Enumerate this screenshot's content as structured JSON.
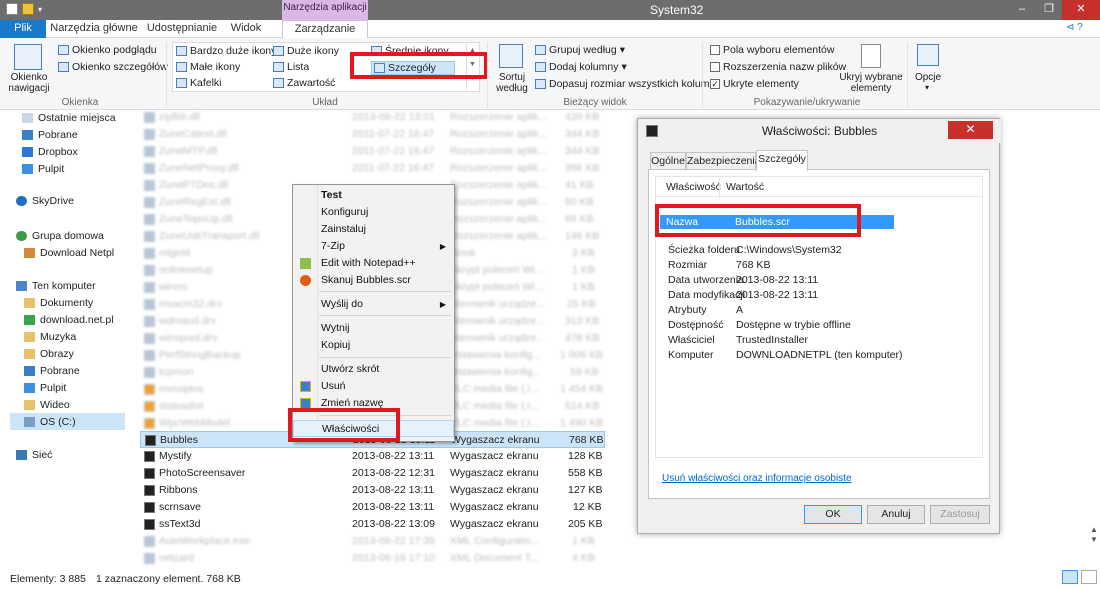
{
  "window": {
    "title": "System32",
    "contextual_tools": "Narzędzia aplikacji",
    "controls": [
      "–",
      "❐",
      "✕"
    ]
  },
  "tabs": [
    "Plik",
    "Narzędzia główne",
    "Udostępnianie",
    "Widok",
    "Zarządzanie"
  ],
  "ribbon": {
    "okienka": {
      "nav_pane": "Okienko nawigacji",
      "preview": "Okienko podglądu",
      "details": "Okienko szczegółów",
      "label": "Okienka"
    },
    "uklad": {
      "items": [
        "Bardzo duże ikony",
        "Duże ikony",
        "Średnie ikony",
        "Małe ikony",
        "Lista",
        "Szczegóły",
        "Kafelki",
        "Zawartość"
      ],
      "label": "Układ"
    },
    "biezacy": {
      "sort": "Sortuj według",
      "group": "Grupuj według",
      "add_cols": "Dodaj kolumny",
      "fit_cols": "Dopasuj rozmiar wszystkich kolumn",
      "label": "Bieżący widok"
    },
    "pokazywanie": {
      "checkboxes": "Pola wyboru elementów",
      "extensions": "Rozszerzenia nazw plików",
      "hidden": "Ukryte elementy",
      "hide_selected": "Ukryj wybrane elementy",
      "options": "Opcje",
      "label": "Pokazywanie/ukrywanie"
    }
  },
  "nav": [
    {
      "label": "Ostatnie miejsca",
      "icon": "recent-places-icon"
    },
    {
      "label": "Pobrane",
      "icon": "downloads-icon"
    },
    {
      "label": "Dropbox",
      "icon": "dropbox-icon"
    },
    {
      "label": "Pulpit",
      "icon": "desktop-icon"
    },
    {
      "label": "SkyDrive",
      "icon": "skydrive-icon"
    },
    {
      "label": "Grupa domowa",
      "icon": "homegroup-icon"
    },
    {
      "label": "Download Netpl",
      "icon": "user-icon"
    },
    {
      "label": "Ten komputer",
      "icon": "computer-icon"
    },
    {
      "label": "Dokumenty",
      "icon": "documents-icon"
    },
    {
      "label": "download.net.pl",
      "icon": "network-folder-icon"
    },
    {
      "label": "Muzyka",
      "icon": "music-icon"
    },
    {
      "label": "Obrazy",
      "icon": "pictures-icon"
    },
    {
      "label": "Pobrane",
      "icon": "downloads-icon"
    },
    {
      "label": "Pulpit",
      "icon": "desktop-icon"
    },
    {
      "label": "Wideo",
      "icon": "video-icon"
    },
    {
      "label": "OS (C:)",
      "icon": "drive-icon"
    },
    {
      "label": "Sieć",
      "icon": "network-icon"
    }
  ],
  "files_visible": [
    {
      "name": "Bubbles",
      "date": "2013-08-22 13:11",
      "type": "Wygaszacz ekranu",
      "size": "768 KB"
    },
    {
      "name": "Mystify",
      "date": "2013-08-22 13:11",
      "type": "Wygaszacz ekranu",
      "size": "128 KB"
    },
    {
      "name": "PhotoScreensaver",
      "date": "2013-08-22 12:31",
      "type": "Wygaszacz ekranu",
      "size": "558 KB"
    },
    {
      "name": "Ribbons",
      "date": "2013-08-22 13:11",
      "type": "Wygaszacz ekranu",
      "size": "127 KB"
    },
    {
      "name": "scrnsave",
      "date": "2013-08-22 13:11",
      "type": "Wygaszacz ekranu",
      "size": "12 KB"
    },
    {
      "name": "ssText3d",
      "date": "2013-08-22 13:09",
      "type": "Wygaszacz ekranu",
      "size": "205 KB"
    }
  ],
  "context_menu": [
    "Test",
    "Konfiguruj",
    "Zainstaluj",
    "7-Zip",
    "Edit with Notepad++",
    "Skanuj Bubbles.scr",
    "Wyślij do",
    "Wytnij",
    "Kopiuj",
    "Utwórz skrót",
    "Usuń",
    "Zmień nazwę",
    "Właściwości"
  ],
  "dialog": {
    "title": "Właściwości: Bubbles",
    "tabs": [
      "Ogólne",
      "Zabezpieczenia",
      "Szczegóły"
    ],
    "header": {
      "property": "Właściwość",
      "value": "Wartość"
    },
    "rows": [
      {
        "k": "Nazwa",
        "v": "Bubbles.scr"
      },
      {
        "k": "Ścieżka folderu",
        "v": "C:\\Windows\\System32"
      },
      {
        "k": "Rozmiar",
        "v": "768 KB"
      },
      {
        "k": "Data utworzenia",
        "v": "2013-08-22 13:11"
      },
      {
        "k": "Data modyfikacji",
        "v": "2013-08-22 13:11"
      },
      {
        "k": "Atrybuty",
        "v": "A"
      },
      {
        "k": "Dostępność",
        "v": "Dostępne w trybie offline"
      },
      {
        "k": "Właściciel",
        "v": "TrustedInstaller"
      },
      {
        "k": "Komputer",
        "v": "DOWNLOADNETPL (ten komputer)"
      }
    ],
    "link": "Usuń właściwości oraz informacje osobiste",
    "buttons": [
      "OK",
      "Anuluj",
      "Zastosuj"
    ]
  },
  "status": {
    "count": "Elementy: 3 885",
    "selected": "1 zaznaczony element. 768 KB"
  },
  "colors": {
    "accent": "#1979ca",
    "highlight": "#e3171e",
    "selection": "#cce4f7"
  }
}
